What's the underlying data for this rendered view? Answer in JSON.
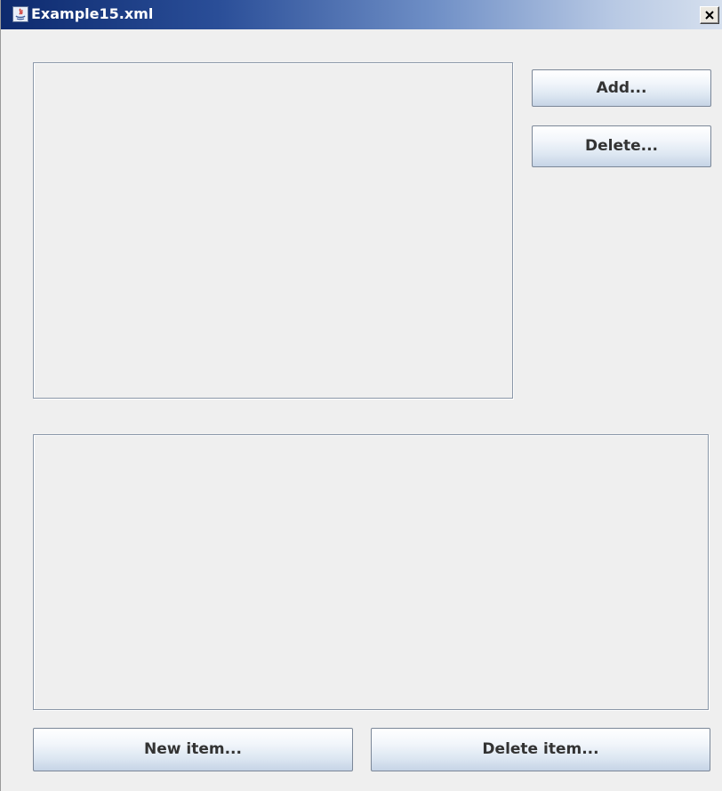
{
  "window": {
    "title": "Example15.xml",
    "app_icon": "java-app-icon",
    "close_icon": "close-icon",
    "close_label": "Close"
  },
  "panels": {
    "top_list": {
      "items": []
    },
    "bottom_list": {
      "items": []
    }
  },
  "buttons": {
    "add_label": "Add...",
    "delete_label": "Delete...",
    "new_item_label": "New item...",
    "delete_item_label": "Delete item..."
  },
  "colors": {
    "title_gradient_start": "#0d2a6e",
    "title_gradient_end": "#d6e0ee",
    "window_background": "#efefef",
    "button_border": "#7b8798"
  }
}
